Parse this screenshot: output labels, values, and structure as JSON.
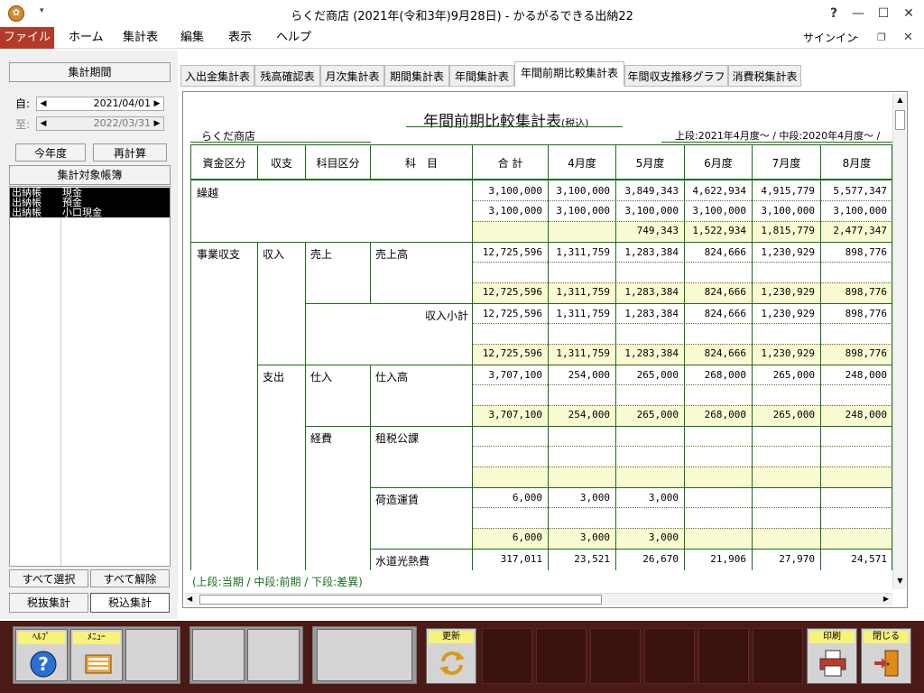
{
  "window": {
    "title": "らくだ商店 (2021年(令和3年)9月28日) - かるがるできる出納22",
    "help_glyph": "?"
  },
  "menubar": {
    "items": [
      "ファイル",
      "ホーム",
      "集計表",
      "編集",
      "表示",
      "ヘルプ"
    ],
    "signin": "サインイン"
  },
  "left_panel": {
    "period_title": "集計期間",
    "from_label": "自:",
    "from_date": "2021/04/01",
    "to_label": "至:",
    "to_date": "2022/03/31",
    "this_year_button": "今年度",
    "recalc_button": "再計算",
    "ledger_title": "集計対象帳簿",
    "ledgers": [
      {
        "type": "出納帳",
        "name": "現金"
      },
      {
        "type": "出納帳",
        "name": "預金"
      },
      {
        "type": "出納帳",
        "name": "小口現金"
      }
    ],
    "select_all_button": "すべて選択",
    "deselect_all_button": "すべて解除",
    "tax_excl_button": "税抜集計",
    "tax_incl_button": "税込集計"
  },
  "tabs": [
    "入出金集計表",
    "残高確認表",
    "月次集計表",
    "期間集計表",
    "年間集計表",
    "年間前期比較集計表",
    "年間収支推移グラフ",
    "消費税集計表"
  ],
  "active_tab": "年間前期比較集計表",
  "report": {
    "title": "年間前期比較集計表",
    "title_suffix": "(税込)",
    "shop_name": "らくだ商店",
    "periods": "上段:2021年4月度～ / 中段:2020年4月度～ /",
    "headers": [
      "資金区分",
      "収支",
      "科目区分",
      "科　目",
      "合 計",
      "4月度",
      "5月度",
      "6月度",
      "7月度",
      "8月度"
    ],
    "labels": {
      "carryover": "繰越",
      "business": "事業収支",
      "income": "収入",
      "sales_cat": "売上",
      "sales": "売上高",
      "income_subtotal": "収入小計",
      "expense": "支出",
      "purchase_cat": "仕入",
      "purchase": "仕入高",
      "expense_cat": "経費",
      "tax": "租税公課",
      "freight": "荷造運賃",
      "utilities": "水道光熱費"
    },
    "rows": {
      "carryover": [
        [
          "3,100,000",
          "3,100,000",
          "3,849,343",
          "4,622,934",
          "4,915,779",
          "5,577,347"
        ],
        [
          "3,100,000",
          "3,100,000",
          "3,100,000",
          "3,100,000",
          "3,100,000",
          "3,100,000"
        ],
        [
          "",
          "",
          "749,343",
          "1,522,934",
          "1,815,779",
          "2,477,347"
        ]
      ],
      "sales": [
        [
          "12,725,596",
          "1,311,759",
          "1,283,384",
          "824,666",
          "1,230,929",
          "898,776"
        ],
        [
          "",
          "",
          "",
          "",
          "",
          ""
        ],
        [
          "12,725,596",
          "1,311,759",
          "1,283,384",
          "824,666",
          "1,230,929",
          "898,776"
        ]
      ],
      "income_subtotal": [
        [
          "12,725,596",
          "1,311,759",
          "1,283,384",
          "824,666",
          "1,230,929",
          "898,776"
        ],
        [
          "",
          "",
          "",
          "",
          "",
          ""
        ],
        [
          "12,725,596",
          "1,311,759",
          "1,283,384",
          "824,666",
          "1,230,929",
          "898,776"
        ]
      ],
      "purchase": [
        [
          "3,707,100",
          "254,000",
          "265,000",
          "268,000",
          "265,000",
          "248,000"
        ],
        [
          "",
          "",
          "",
          "",
          "",
          ""
        ],
        [
          "3,707,100",
          "254,000",
          "265,000",
          "268,000",
          "265,000",
          "248,000"
        ]
      ],
      "tax": [
        [
          "",
          "",
          "",
          "",
          "",
          ""
        ],
        [
          "",
          "",
          "",
          "",
          "",
          ""
        ],
        [
          "",
          "",
          "",
          "",
          "",
          ""
        ]
      ],
      "freight": [
        [
          "6,000",
          "3,000",
          "3,000",
          "",
          "",
          ""
        ],
        [
          "",
          "",
          "",
          "",
          "",
          ""
        ],
        [
          "6,000",
          "3,000",
          "3,000",
          "",
          "",
          ""
        ]
      ],
      "utilities": [
        [
          "317,011",
          "23,521",
          "26,670",
          "21,906",
          "27,970",
          "24,571"
        ]
      ]
    },
    "legend": "(上段:当期 / 中段:前期 / 下段:差異)"
  },
  "bottombar": {
    "help_label": "ﾍﾙﾌﾟ",
    "menu_label": "ﾒﾆｭｰ",
    "refresh_label": "更新",
    "print_label": "印刷",
    "close_label": "閉じる"
  }
}
